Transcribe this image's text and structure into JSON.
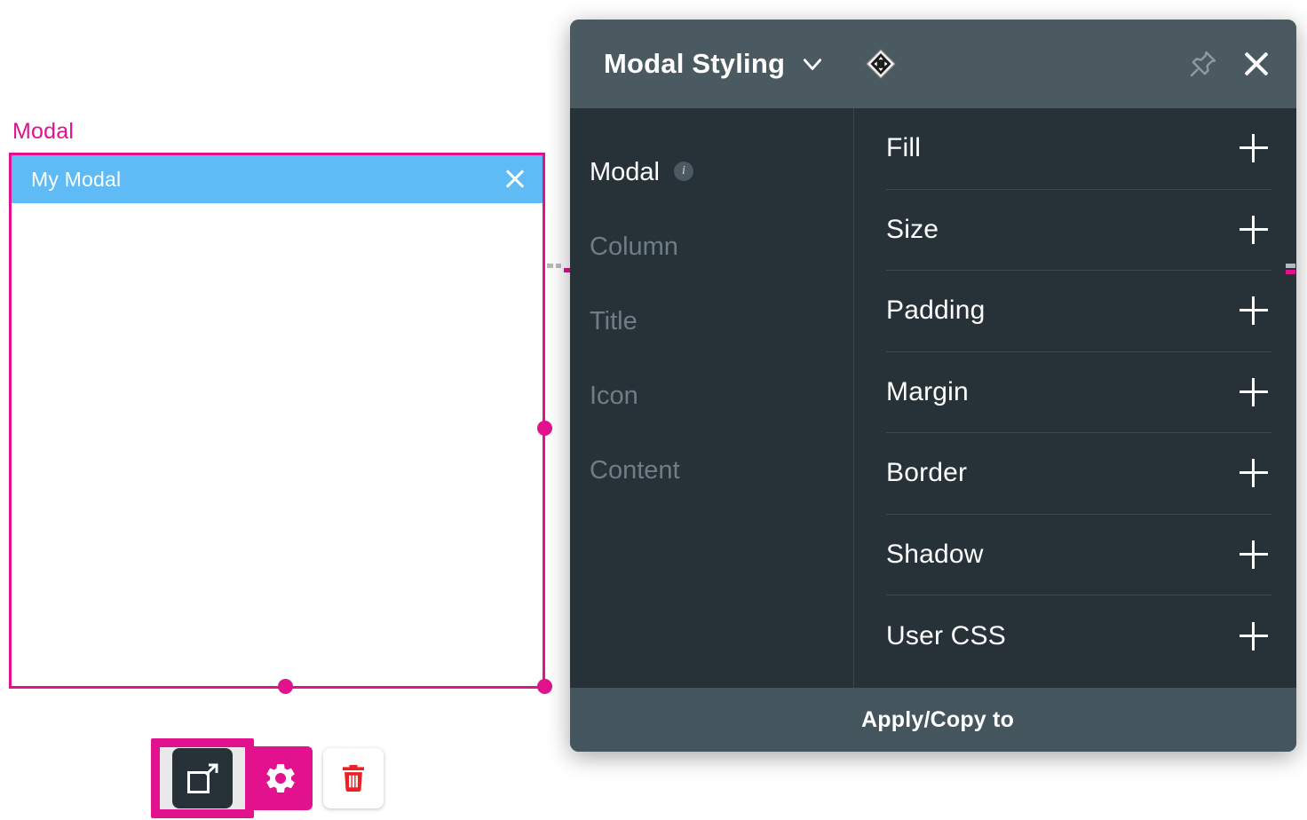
{
  "canvas": {
    "widget_label": "Modal",
    "modal_preview": {
      "title": "My Modal",
      "close_icon": "close-x-icon",
      "titlebar_color": "#5fbbf5",
      "selection_color": "#e2128f"
    },
    "action_toolbar": {
      "open_button": {
        "icon": "external-link-icon",
        "selected": true
      },
      "settings_button": {
        "icon": "gear-icon"
      },
      "delete_button": {
        "icon": "trash-icon"
      }
    }
  },
  "panel": {
    "title": "Modal Styling",
    "title_chevron_icon": "chevron-down-icon",
    "move_cursor_icon": "move-cursor-icon",
    "pin_icon": "pin-icon",
    "close_icon": "close-x-icon",
    "header_color": "#4b5960",
    "body_color": "#273238",
    "sidebar": {
      "items": [
        {
          "label": "Modal",
          "active": true,
          "info_icon": "info-icon"
        },
        {
          "label": "Column",
          "active": false
        },
        {
          "label": "Title",
          "active": false
        },
        {
          "label": "Icon",
          "active": false
        },
        {
          "label": "Content",
          "active": false
        }
      ]
    },
    "properties": [
      {
        "label": "Fill",
        "add_icon": "plus-icon"
      },
      {
        "label": "Size",
        "add_icon": "plus-icon"
      },
      {
        "label": "Padding",
        "add_icon": "plus-icon"
      },
      {
        "label": "Margin",
        "add_icon": "plus-icon"
      },
      {
        "label": "Border",
        "add_icon": "plus-icon"
      },
      {
        "label": "Shadow",
        "add_icon": "plus-icon"
      },
      {
        "label": "User CSS",
        "add_icon": "plus-icon"
      }
    ],
    "footer": {
      "label": "Apply/Copy to"
    }
  }
}
